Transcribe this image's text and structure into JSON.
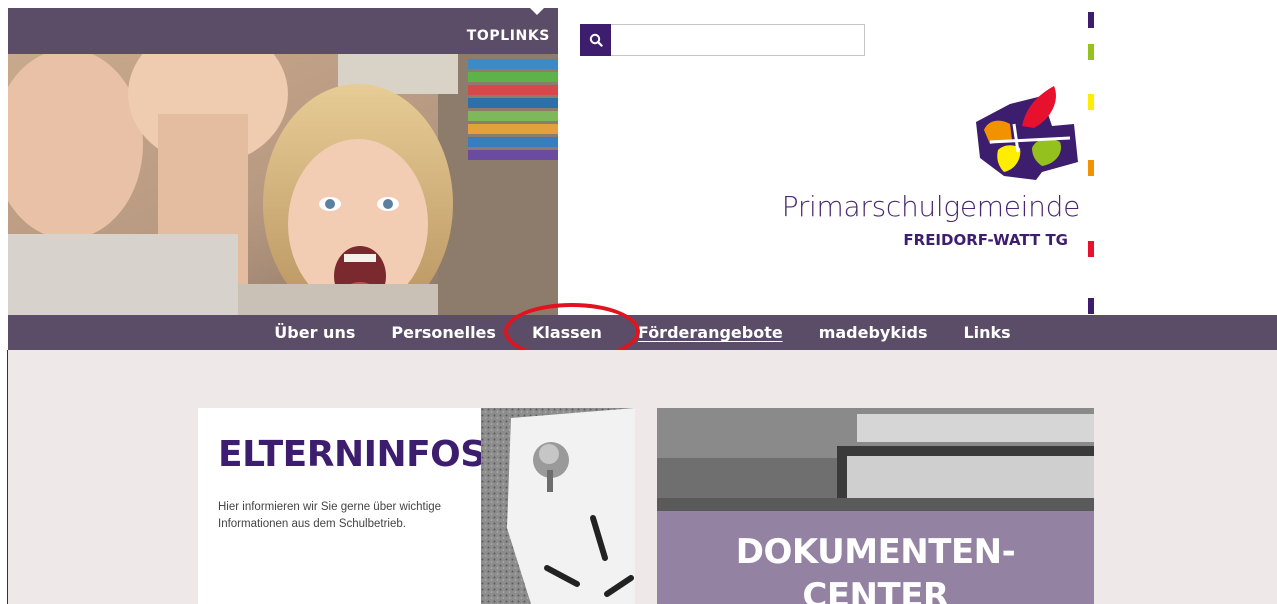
{
  "header": {
    "toplinks_label": "TOPLINKS",
    "search": {
      "placeholder": "",
      "value": ""
    },
    "logo": {
      "title": "Primarschulgemeinde",
      "subtitle": "FREIDORF-WATT TG",
      "colors": [
        "#3d1d6e",
        "#e8112d",
        "#f39200",
        "#c5d500",
        "#95c11f",
        "#ffed00"
      ]
    },
    "strip_colors": [
      "#3d1d6e",
      "#95c11f",
      "#ffed00",
      "#f39200",
      "#e8112d",
      "#3d1d6e"
    ]
  },
  "nav": {
    "items": [
      {
        "label": "Über uns",
        "active": false
      },
      {
        "label": "Personelles",
        "active": false
      },
      {
        "label": "Klassen",
        "active": false,
        "highlighted": true
      },
      {
        "label": "Förderangebote",
        "active": true
      },
      {
        "label": "madebykids",
        "active": false
      },
      {
        "label": "Links",
        "active": false
      }
    ]
  },
  "cards": {
    "elterninfos": {
      "title": "ELTERNINFOS",
      "description": "Hier informieren wir Sie gerne über wichtige Informationen aus dem Schulbetrieb."
    },
    "dokumentencenter": {
      "title_line1": "DOKUMENTEN-",
      "title_line2": "CENTER"
    }
  },
  "theme": {
    "header_bar": "#5b4d67",
    "accent_purple": "#3d1d6e",
    "content_bg": "#efe8e8",
    "highlight": "#e1131f"
  }
}
